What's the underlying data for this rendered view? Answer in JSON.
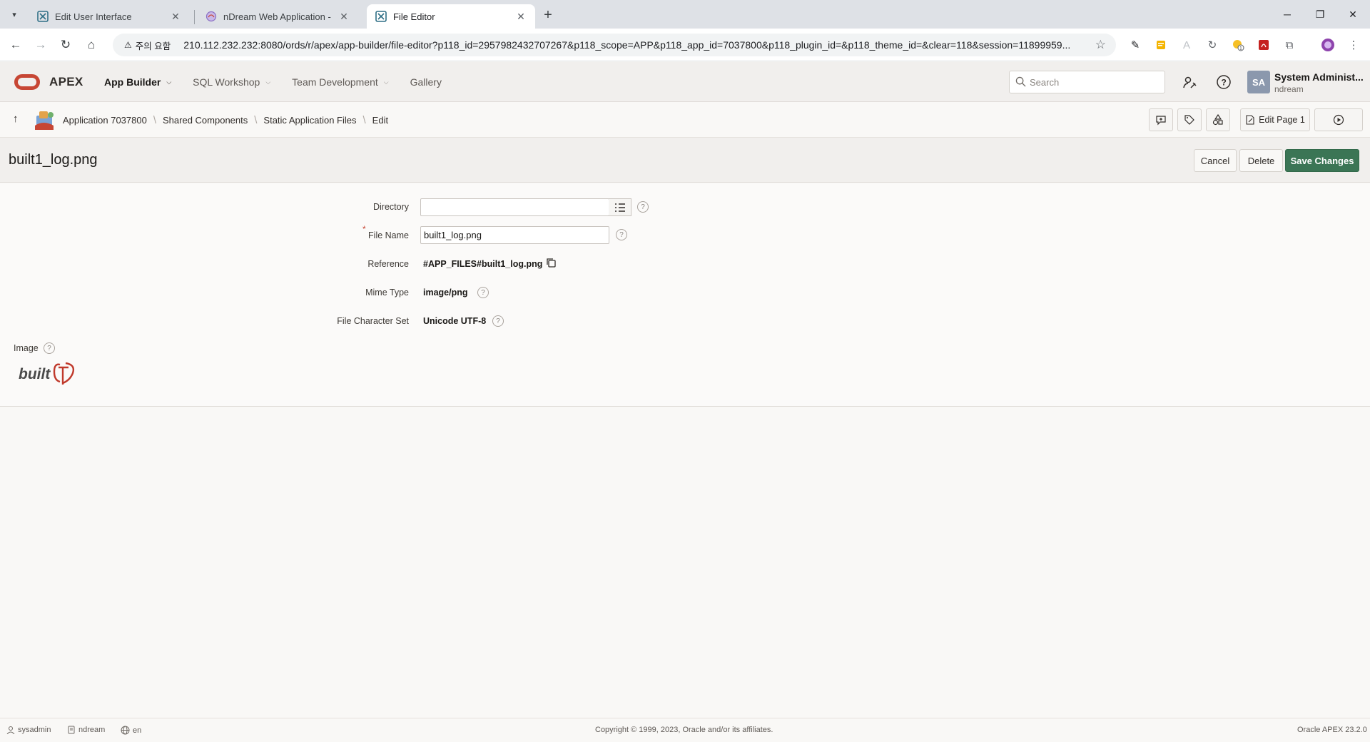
{
  "browser": {
    "tabs": [
      {
        "title": "Edit User Interface"
      },
      {
        "title": "nDream Web Application - Log"
      },
      {
        "title": "File Editor"
      }
    ],
    "security_chip": "주의 요함",
    "url": "210.112.232.232:8080/ords/r/apex/app-builder/file-editor?p118_id=2957982432707267&p118_scope=APP&p118_app_id=7037800&p118_plugin_id=&p118_theme_id=&clear=118&session=11899959..."
  },
  "header": {
    "product": "APEX",
    "menu": [
      {
        "label": "App Builder"
      },
      {
        "label": "SQL Workshop"
      },
      {
        "label": "Team Development"
      },
      {
        "label": "Gallery"
      }
    ],
    "search_placeholder": "Search",
    "avatar_initials": "SA",
    "user_name": "System Administ...",
    "workspace": "ndream"
  },
  "breadcrumb": {
    "items": [
      "Application 7037800",
      "Shared Components",
      "Static Application Files",
      "Edit"
    ],
    "edit_page_label": "Edit Page 1"
  },
  "page": {
    "title": "built1_log.png",
    "cancel_label": "Cancel",
    "delete_label": "Delete",
    "save_label": "Save Changes"
  },
  "form": {
    "directory_label": "Directory",
    "directory_value": "",
    "file_name_label": "File Name",
    "file_name_value": "built1_log.png",
    "reference_label": "Reference",
    "reference_value": "#APP_FILES#built1_log.png",
    "mime_label": "Mime Type",
    "mime_value": "image/png",
    "charset_label": "File Character Set",
    "charset_value": "Unicode UTF-8",
    "image_label": "Image",
    "image_logo_text": "built"
  },
  "footer": {
    "user": "sysadmin",
    "workspace": "ndream",
    "language": "en",
    "copyright": "Copyright © 1999, 2023, Oracle and/or its affiliates.",
    "version": "Oracle APEX 23.2.0"
  },
  "colors": {
    "hot_button": "#3b7555",
    "apex_red": "#c74634"
  }
}
